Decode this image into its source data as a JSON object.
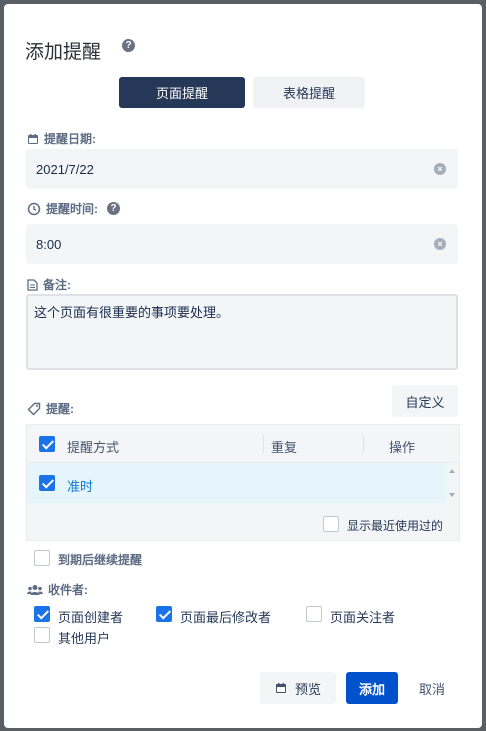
{
  "dialog": {
    "title": "添加提醒",
    "help_icon": "?",
    "tabs": [
      "页面提醒",
      "表格提醒"
    ],
    "date": {
      "label": "提醒日期:",
      "value": "2021/7/22"
    },
    "time": {
      "label": "提醒时间:",
      "value": "8:00"
    },
    "note": {
      "label": "备注:",
      "value": "这个页面有很重要的事项要处理。"
    },
    "reminder": {
      "label": "提醒:",
      "custom_button": "自定义",
      "columns": [
        "提醒方式",
        "重复",
        "操作"
      ],
      "rows": [
        {
          "method": "准时",
          "checked": true
        }
      ],
      "show_recent_label": "显示最近使用过的"
    },
    "continue_after_due": "到期后继续提醒",
    "recipients": {
      "label": "收件者:",
      "options": [
        {
          "label": "页面创建者",
          "checked": true
        },
        {
          "label": "页面最后修改者",
          "checked": true
        },
        {
          "label": "页面关注者",
          "checked": false
        },
        {
          "label": "其他用户",
          "checked": false
        }
      ]
    },
    "footer": {
      "preview": "预览",
      "add": "添加",
      "cancel": "取消"
    }
  },
  "colors": {
    "primary": "#0052cc",
    "tab_active": "#253858",
    "link": "#0b7ad1"
  }
}
